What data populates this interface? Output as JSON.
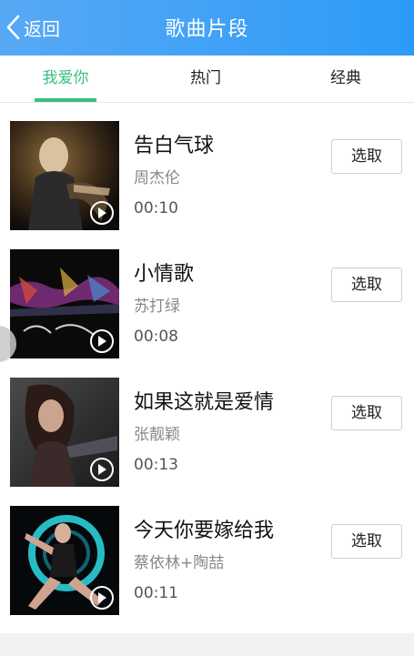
{
  "header": {
    "back_label": "返回",
    "title": "歌曲片段"
  },
  "tabs": [
    {
      "label": "我爱你",
      "active": true
    },
    {
      "label": "热门",
      "active": false
    },
    {
      "label": "经典",
      "active": false
    }
  ],
  "songs": [
    {
      "title": "告白气球",
      "artist": "周杰伦",
      "duration": "00:10",
      "action": "选取"
    },
    {
      "title": "小情歌",
      "artist": "苏打绿",
      "duration": "00:08",
      "action": "选取"
    },
    {
      "title": "如果这就是爱情",
      "artist": "张靓颖",
      "duration": "00:13",
      "action": "选取"
    },
    {
      "title": "今天你要嫁给我",
      "artist": "蔡依林+陶喆",
      "duration": "00:11",
      "action": "选取"
    }
  ],
  "colors": {
    "header_gradient_start": "#57a9f5",
    "header_gradient_end": "#2c9bf7",
    "tab_active": "#3bbf7f"
  },
  "icons": {
    "back": "chevron-left-icon",
    "play": "play-icon"
  }
}
